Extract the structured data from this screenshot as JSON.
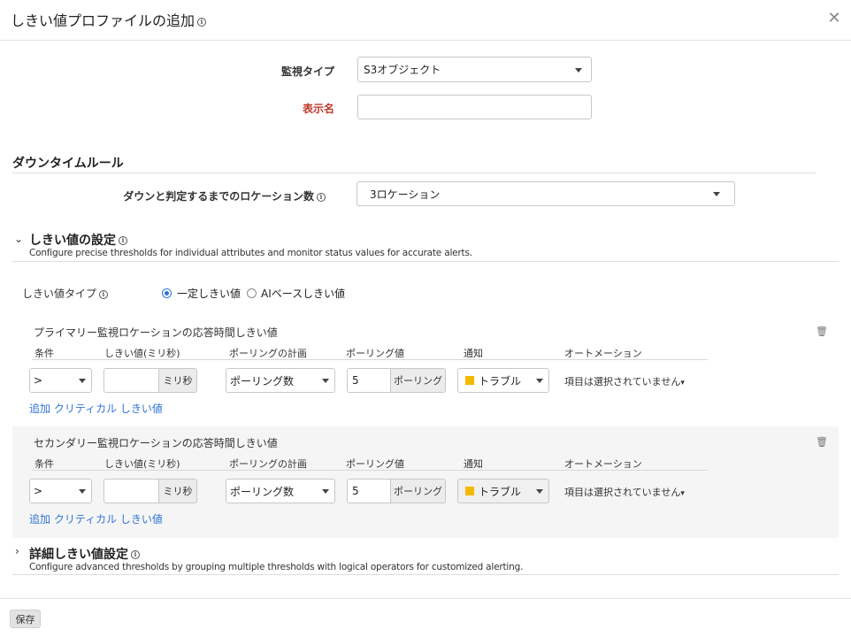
{
  "dialog": {
    "title": "しきい値プロファイルの追加",
    "close_glyph": "✕"
  },
  "form": {
    "monitor_type_label": "監視タイプ",
    "monitor_type_value": "S3オブジェクト",
    "display_name_label": "表示名",
    "display_name_value": ""
  },
  "downtime": {
    "title": "ダウンタイムルール",
    "locations_label": "ダウンと判定するまでのロケーション数",
    "locations_value": "3ロケーション"
  },
  "threshold_settings": {
    "title": "しきい値の設定",
    "description": "Configure precise thresholds for individual attributes and monitor status values for accurate alerts.",
    "type_label": "しきい値タイプ",
    "options": [
      "一定しきい値",
      "AIベースしきい値"
    ],
    "selected_index": 0
  },
  "columns": {
    "condition": "条件",
    "threshold_ms": "しきい値(ミリ秒)",
    "poll_plan": "ポーリングの計画",
    "poll_value": "ポーリング値",
    "notification": "通知",
    "automation": "オートメーション"
  },
  "blocks": [
    {
      "title": "プライマリー監視ロケーションの応答時間しきい値",
      "condition": ">",
      "threshold_value": "",
      "threshold_unit": "ミリ秒",
      "poll_plan": "ポーリング数",
      "poll_value": "5",
      "poll_unit": "ポーリング",
      "notification": "トラブル",
      "automation": "項目は選択されていません",
      "add_link": "追加 クリティカル しきい値"
    },
    {
      "title": "セカンダリー監視ロケーションの応答時間しきい値",
      "condition": ">",
      "threshold_value": "",
      "threshold_unit": "ミリ秒",
      "poll_plan": "ポーリング数",
      "poll_value": "5",
      "poll_unit": "ポーリング",
      "notification": "トラブル",
      "automation": "項目は選択されていません",
      "add_link": "追加 クリティカル しきい値"
    }
  ],
  "advanced": {
    "title": "詳細しきい値設定",
    "description": "Configure advanced thresholds by grouping multiple thresholds with logical operators for customized alerting."
  },
  "footer": {
    "save_label": "保存"
  },
  "colors": {
    "accent": "#2f74d8",
    "required_label": "#c0392b",
    "notification_trouble": "#f5b800"
  },
  "icons": [
    "info-icon",
    "close-icon",
    "chevron-down-icon",
    "chevron-right-icon",
    "trash-icon",
    "caret-down-icon"
  ]
}
